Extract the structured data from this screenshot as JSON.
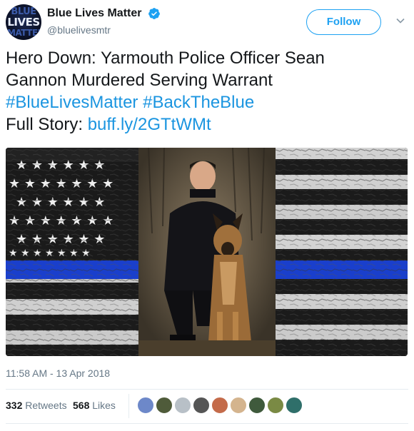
{
  "account": {
    "display_name": "Blue Lives Matter",
    "handle": "@bluelivesmtr",
    "verified": true,
    "avatar_lines": [
      "BLUE",
      "LIVES",
      "MATTER"
    ],
    "verified_icon": "verified-badge-icon"
  },
  "follow_label": "Follow",
  "menu_icon": "chevron-down-icon",
  "tweet": {
    "line1": "Hero Down: Yarmouth Police Officer Sean",
    "line2": "Gannon Murdered Serving Warrant",
    "hashtag1": "#BlueLivesMatter",
    "hashtag2": "#BackTheBlue",
    "full_story_label": "Full Story:",
    "link": "buff.ly/2GTtWMt"
  },
  "photo": {
    "description_icon": "thin-blue-line-flag-officer-with-k9-photo"
  },
  "timestamp": "11:58 AM - 13 Apr 2018",
  "stats": {
    "retweets_count": "332",
    "retweets_label": "Retweets",
    "likes_count": "568",
    "likes_label": "Likes"
  },
  "colors": {
    "accent": "#1da1f2",
    "link": "#1b95e0",
    "muted": "#657786",
    "text": "#14171a"
  }
}
